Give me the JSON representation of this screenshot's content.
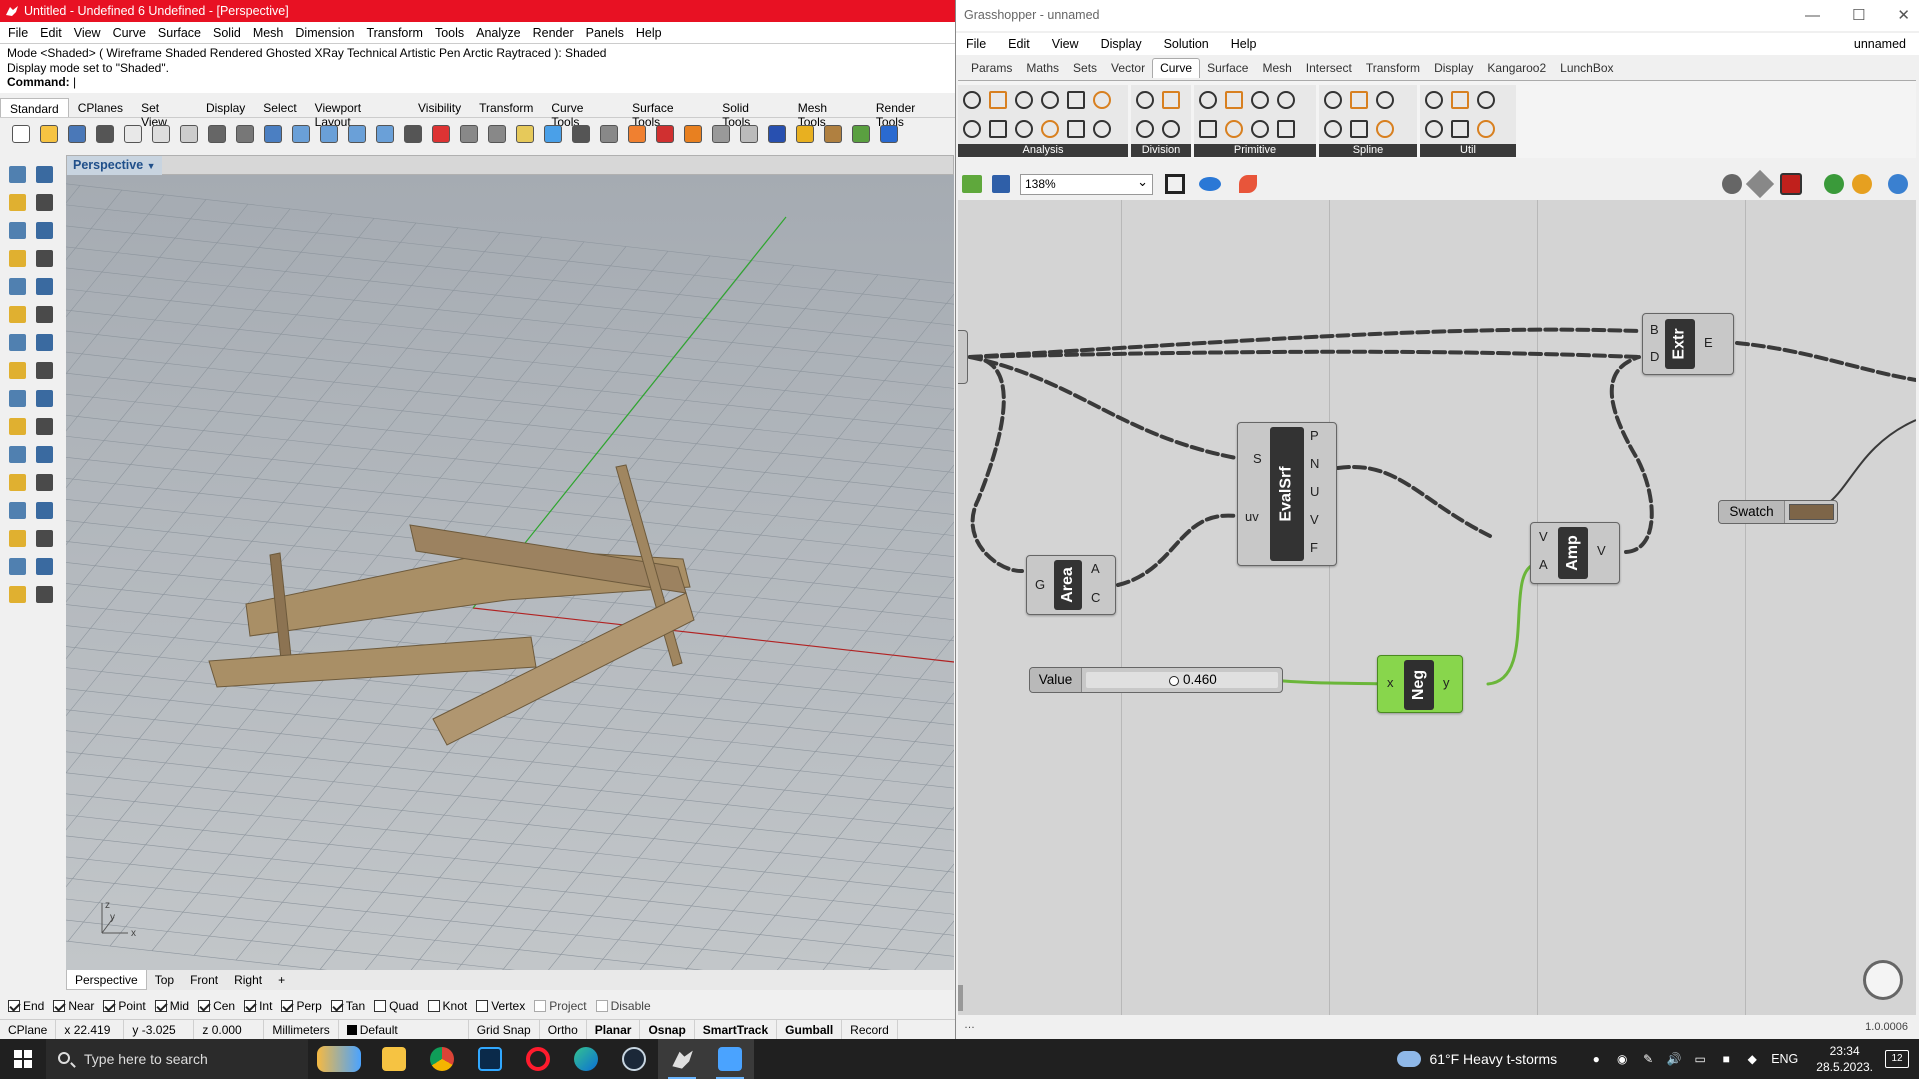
{
  "rhino": {
    "title": "Untitled - Undefined 6 Undefined - [Perspective]",
    "menu": [
      "File",
      "Edit",
      "View",
      "Curve",
      "Surface",
      "Solid",
      "Mesh",
      "Dimension",
      "Transform",
      "Tools",
      "Analyze",
      "Render",
      "Panels",
      "Help"
    ],
    "command_history": [
      "Mode <Shaded> ( Wireframe  Shaded  Rendered  Ghosted  XRay  Technical  Artistic  Pen  Arctic  Raytraced ): Shaded",
      "Display mode set to \"Shaded\"."
    ],
    "command_prompt": "Command:",
    "toolbar_tabs": [
      "Standard",
      "CPlanes",
      "Set View",
      "Display",
      "Select",
      "Viewport Layout",
      "Visibility",
      "Transform",
      "Curve Tools",
      "Surface Tools",
      "Solid Tools",
      "Mesh Tools",
      "Render Tools"
    ],
    "active_toolbar_tab": "Standard",
    "viewport_title": "Perspective",
    "viewport_tabs": [
      "Perspective",
      "Top",
      "Front",
      "Right"
    ],
    "active_viewport_tab": "Perspective",
    "add_viewport_symbol": "+",
    "axis_labels": {
      "z": "z",
      "y": "y",
      "x": "x"
    },
    "osnaps": [
      {
        "label": "End",
        "checked": true
      },
      {
        "label": "Near",
        "checked": true
      },
      {
        "label": "Point",
        "checked": true
      },
      {
        "label": "Mid",
        "checked": true
      },
      {
        "label": "Cen",
        "checked": true
      },
      {
        "label": "Int",
        "checked": true
      },
      {
        "label": "Perp",
        "checked": true
      },
      {
        "label": "Tan",
        "checked": true
      },
      {
        "label": "Quad",
        "checked": false
      },
      {
        "label": "Knot",
        "checked": false
      },
      {
        "label": "Vertex",
        "checked": false
      },
      {
        "label": "Project",
        "checked": false,
        "disabled": true
      },
      {
        "label": "Disable",
        "checked": false,
        "disabled": true
      }
    ],
    "status": {
      "cplane": "CPlane",
      "x": "x 22.419",
      "y": "y -3.025",
      "z": "z 0.000",
      "units": "Millimeters",
      "layer": "Default",
      "grid_snap": "Grid Snap",
      "ortho": "Ortho",
      "planar": "Planar",
      "osnap": "Osnap",
      "smarttrack": "SmartTrack",
      "gumball": "Gumball",
      "record": "Record"
    },
    "colors": {
      "title_bar": "#e81123",
      "timber": "#a98f66",
      "x_axis": "#b22222",
      "y_axis": "#2fa62f"
    }
  },
  "grasshopper": {
    "title": "Grasshopper - unnamed",
    "menu": [
      "File",
      "Edit",
      "View",
      "Display",
      "Solution",
      "Help"
    ],
    "doc_name": "unnamed",
    "tabs": [
      "Params",
      "Maths",
      "Sets",
      "Vector",
      "Curve",
      "Surface",
      "Mesh",
      "Intersect",
      "Transform",
      "Display",
      "Kangaroo2",
      "LunchBox"
    ],
    "active_tab": "Curve",
    "ribbon_groups": [
      "Analysis",
      "Division",
      "Primitive",
      "Spline",
      "Util"
    ],
    "zoom": "138%",
    "components": {
      "extr": {
        "name": "Extr",
        "inputs": [
          "B",
          "D"
        ],
        "outputs": [
          "E"
        ]
      },
      "evalsrf": {
        "name": "EvalSrf",
        "inputs": [
          "S",
          "uv"
        ],
        "outputs": [
          "P",
          "N",
          "U",
          "V",
          "F"
        ]
      },
      "area": {
        "name": "Area",
        "inputs": [
          "G"
        ],
        "outputs": [
          "A",
          "C"
        ]
      },
      "amp": {
        "name": "Amp",
        "inputs": [
          "V",
          "A"
        ],
        "outputs": [
          "V"
        ]
      },
      "neg": {
        "name": "Neg",
        "inputs": [
          "x"
        ],
        "outputs": [
          "y"
        ]
      }
    },
    "slider": {
      "label": "Value",
      "value": "0.460",
      "fraction": 0.46
    },
    "swatch": {
      "label": "Swatch",
      "color": "#7d6548"
    },
    "version": "1.0.0006"
  },
  "taskbar": {
    "search_placeholder": "Type here to search",
    "weather": "61°F  Heavy t-storms",
    "lang": "ENG",
    "time": "23:34",
    "date": "28.5.2023.",
    "notifications": "12"
  }
}
